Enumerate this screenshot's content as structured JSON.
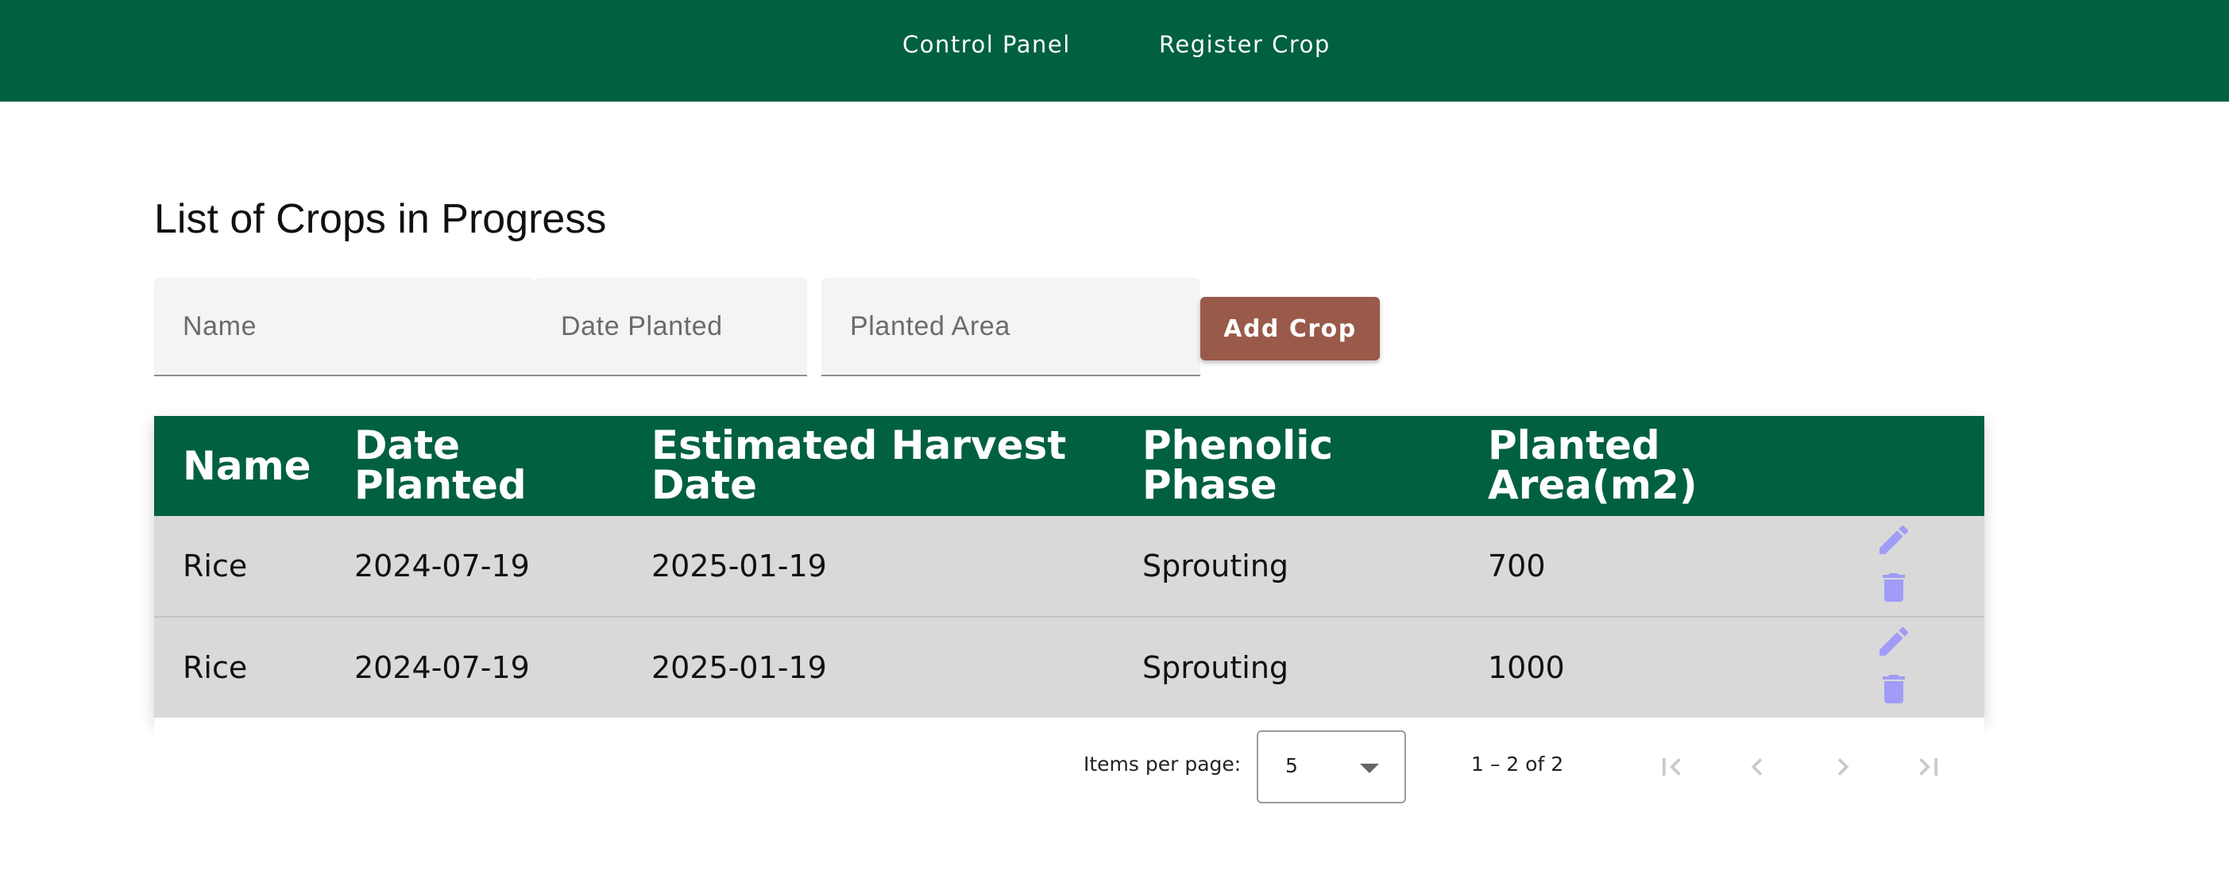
{
  "nav": {
    "control_panel": "Control Panel",
    "register_crop": "Register Crop"
  },
  "page": {
    "title": "List of Crops in Progress"
  },
  "form": {
    "name_placeholder": "Name",
    "date_placeholder": "Date Planted",
    "area_placeholder": "Planted Area",
    "add_button": "Add Crop"
  },
  "table": {
    "headers": {
      "name": "Name",
      "date_planted": "Date\nPlanted",
      "estimated_harvest": "Estimated Harvest\nDate",
      "phenolic_phase": "Phenolic\nPhase",
      "planted_area": "Planted\nArea(m2)"
    },
    "rows": [
      {
        "name": "Rice",
        "date_planted": "2024-07-19",
        "estimated_harvest": "2025-01-19",
        "phase": "Sprouting",
        "area": "700"
      },
      {
        "name": "Rice",
        "date_planted": "2024-07-19",
        "estimated_harvest": "2025-01-19",
        "phase": "Sprouting",
        "area": "1000"
      }
    ],
    "row_actions": [
      "pencil-icon",
      "trash-icon"
    ]
  },
  "paginator": {
    "items_per_page_label": "Items per page:",
    "page_size": "5",
    "range_label": "1 – 2 of 2"
  },
  "colors": {
    "header_green": "#006041",
    "add_button": "#995a4a",
    "row_background": "#d9d9d9",
    "action_icon": "#a09cf7"
  }
}
